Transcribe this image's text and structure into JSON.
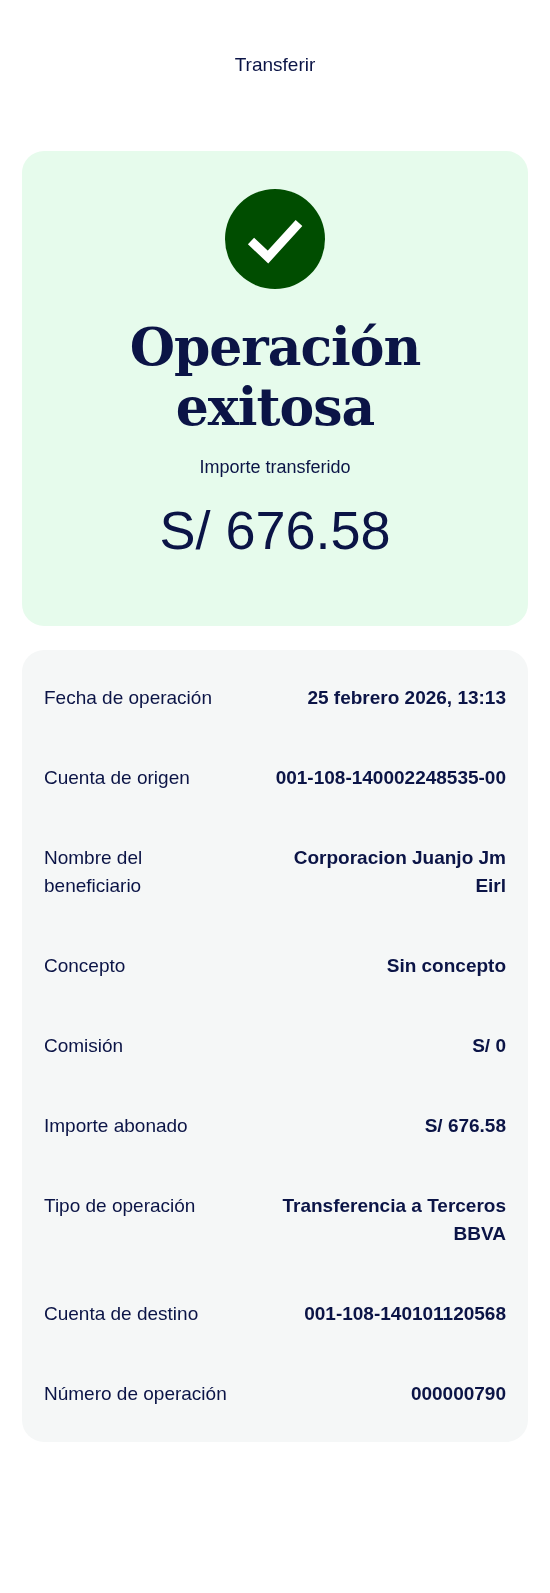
{
  "header": {
    "title": "Transferir"
  },
  "result": {
    "title": "Operación exitosa",
    "amount_label": "Importe transferido",
    "amount": "S/ 676.58"
  },
  "details": [
    {
      "label": "Fecha de operación",
      "value": "25 febrero 2026, 13:13"
    },
    {
      "label": "Cuenta de origen",
      "value": "001-108-140002248535-00"
    },
    {
      "label": "Nombre del beneficiario",
      "value": "Corporacion Juanjo Jm Eirl"
    },
    {
      "label": "Concepto",
      "value": "Sin concepto"
    },
    {
      "label": "Comisión",
      "value": "S/ 0"
    },
    {
      "label": "Importe abonado",
      "value": "S/ 676.58"
    },
    {
      "label": "Tipo de operación",
      "value": "Transferencia a Terceros BBVA"
    },
    {
      "label": "Cuenta de destino",
      "value": "001-108-140101120568"
    },
    {
      "label": "Número de operación",
      "value": "000000790"
    }
  ]
}
